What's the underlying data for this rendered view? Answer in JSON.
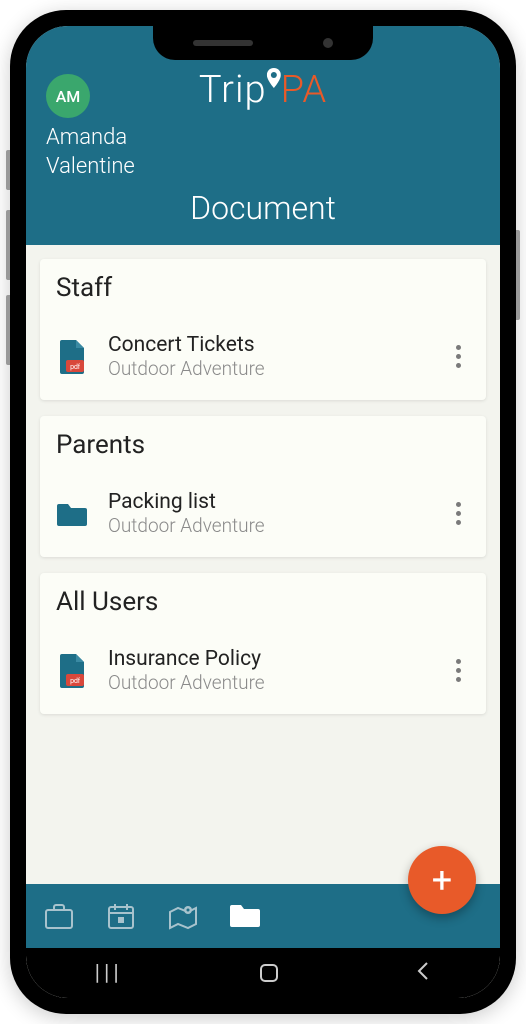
{
  "app": {
    "logo_trip": "Trip",
    "logo_pa": "PA"
  },
  "user": {
    "initials": "AM",
    "name_line1": "Amanda",
    "name_line2": "Valentine"
  },
  "page_title": "Document",
  "sections": [
    {
      "title": "Staff",
      "doc": {
        "icon": "pdf",
        "title": "Concert Tickets",
        "subtitle": "Outdoor Adventure"
      }
    },
    {
      "title": "Parents",
      "doc": {
        "icon": "folder",
        "title": "Packing list",
        "subtitle": "Outdoor Adventure"
      }
    },
    {
      "title": "All Users",
      "doc": {
        "icon": "pdf",
        "title": "Insurance Policy",
        "subtitle": "Outdoor Adventure"
      }
    }
  ],
  "fab_label": "+",
  "colors": {
    "brand_bg": "#1e6e87",
    "accent": "#e85a29",
    "avatar": "#3aa76d",
    "pdf_badge": "#d9483b"
  }
}
